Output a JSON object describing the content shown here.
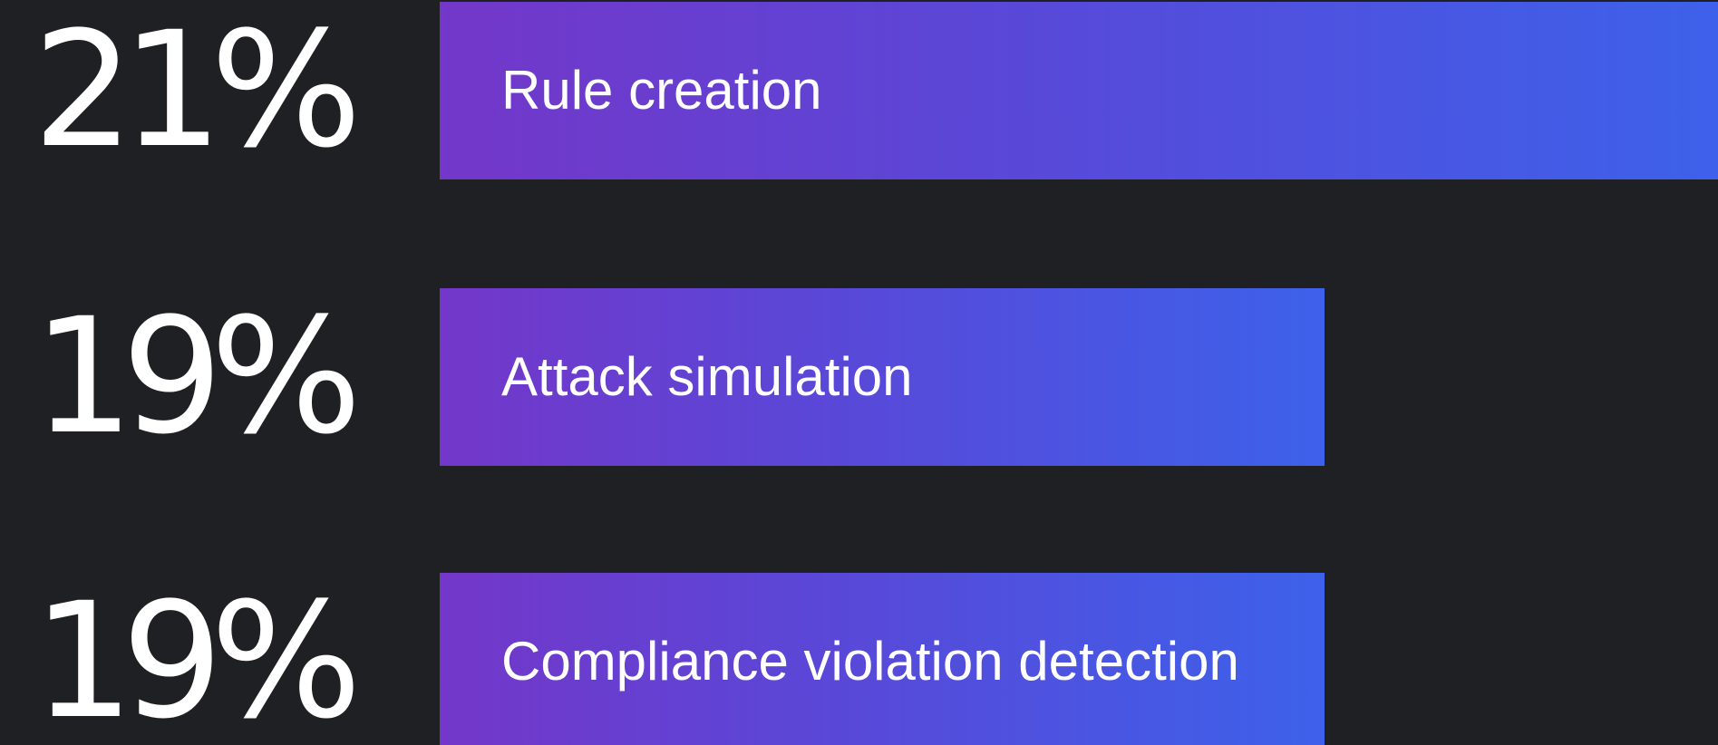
{
  "chart_data": {
    "type": "bar",
    "orientation": "horizontal",
    "title": "",
    "xlabel": "",
    "ylabel": "",
    "categories": [
      "Rule creation",
      "Attack simulation",
      "Compliance violation detection"
    ],
    "values": [
      21,
      19,
      19
    ],
    "value_labels": [
      "21%",
      "19%",
      "19%"
    ],
    "unit": "%",
    "grid": false,
    "legend": "none",
    "bar_gradient": [
      "#7337c9",
      "#3d61ea"
    ],
    "background": "#1f2023",
    "text_color": "#ffffff"
  }
}
